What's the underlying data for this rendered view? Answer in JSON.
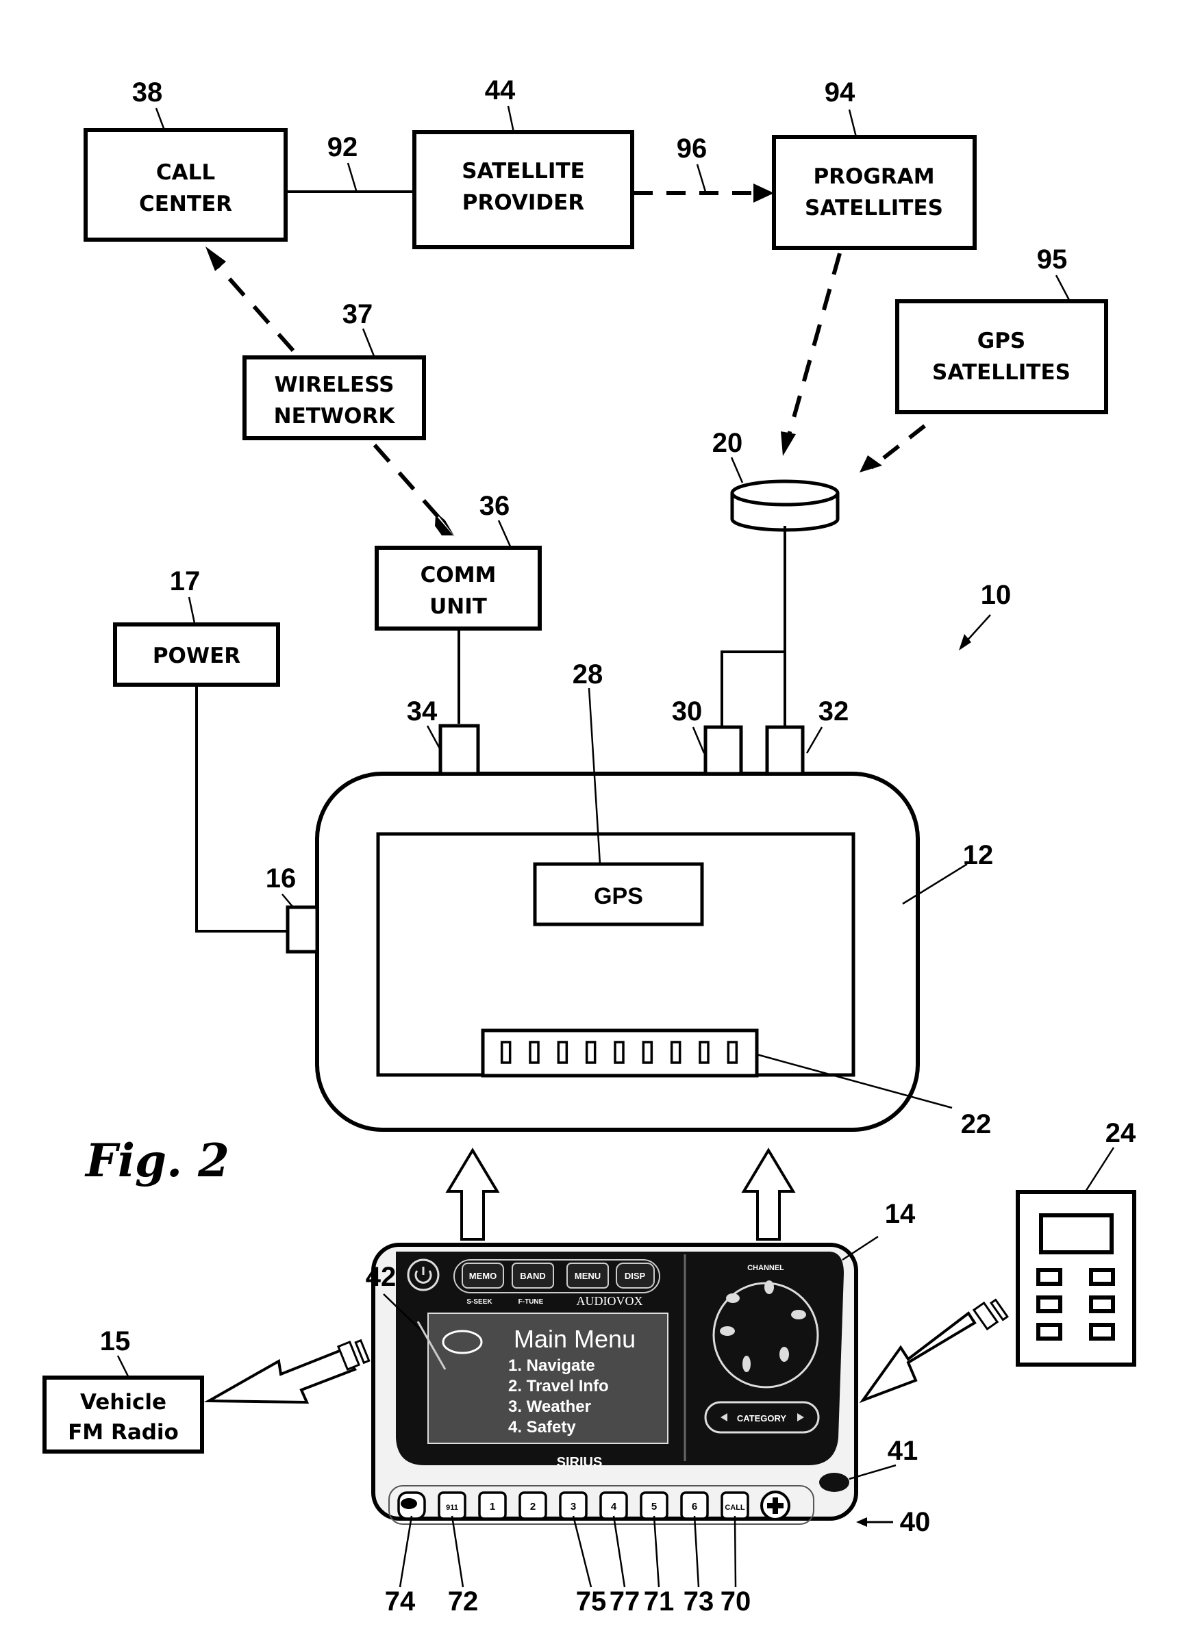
{
  "figure": {
    "title": "Fig. 2",
    "system_ref": "10"
  },
  "blocks": {
    "call_center": {
      "ref": "38",
      "line1": "CALL",
      "line2": "CENTER"
    },
    "satellite_provider": {
      "ref": "44",
      "line1": "SATELLITE",
      "line2": "PROVIDER"
    },
    "program_satellites": {
      "ref": "94",
      "line1": "PROGRAM",
      "line2": "SATELLITES"
    },
    "gps_satellites": {
      "ref": "95",
      "line1": "GPS",
      "line2": "SATELLITES"
    },
    "wireless_network": {
      "ref": "37",
      "line1": "WIRELESS",
      "line2": "NETWORK"
    },
    "comm_unit": {
      "ref": "36",
      "line1": "COMM",
      "line2": "UNIT"
    },
    "power": {
      "ref": "17",
      "label": "POWER"
    },
    "vehicle_fm_radio": {
      "ref": "15",
      "line1": "Vehicle",
      "line2": "FM Radio"
    },
    "gps_module": {
      "ref": "28",
      "label": "GPS"
    }
  },
  "links": {
    "call_to_provider": "92",
    "provider_to_program_sats": "96"
  },
  "main_unit": {
    "ref": "12",
    "power_port_ref": "16",
    "comm_port_ref": "34",
    "port_a_ref": "30",
    "port_b_ref": "32",
    "connector_ref": "22",
    "connector_pins": 9
  },
  "antenna": {
    "ref": "20"
  },
  "remote": {
    "ref": "24",
    "button_count": 6
  },
  "radio_device": {
    "ref": "14",
    "screen_ref": "42",
    "switch_ref": "41",
    "keypad_ref": "40",
    "top_buttons": [
      "MEMO",
      "BAND",
      "MENU",
      "DISP"
    ],
    "sub_labels": [
      "S-SEEK",
      "F-TUNE"
    ],
    "brand": "AUDIOVOX",
    "screen": {
      "title": "Main Menu",
      "items": [
        "1. Navigate",
        "2. Travel Info",
        "3. Weather",
        "4. Safety"
      ]
    },
    "channel_label": "CHANNEL",
    "category_label": "CATEGORY",
    "footer_brand": "SIRIUS",
    "keys": [
      {
        "label": "",
        "ref": "74",
        "icon": "aaa-logo-icon"
      },
      {
        "label": "911",
        "ref": "72"
      },
      {
        "label": "1",
        "ref": ""
      },
      {
        "label": "2",
        "ref": ""
      },
      {
        "label": "3",
        "ref": "75"
      },
      {
        "label": "4",
        "ref": "77"
      },
      {
        "label": "5",
        "ref": "71"
      },
      {
        "label": "6",
        "ref": "73"
      },
      {
        "label": "CALL",
        "ref": "70"
      },
      {
        "label": "",
        "ref": "",
        "icon": "medical-cross-icon"
      }
    ]
  }
}
